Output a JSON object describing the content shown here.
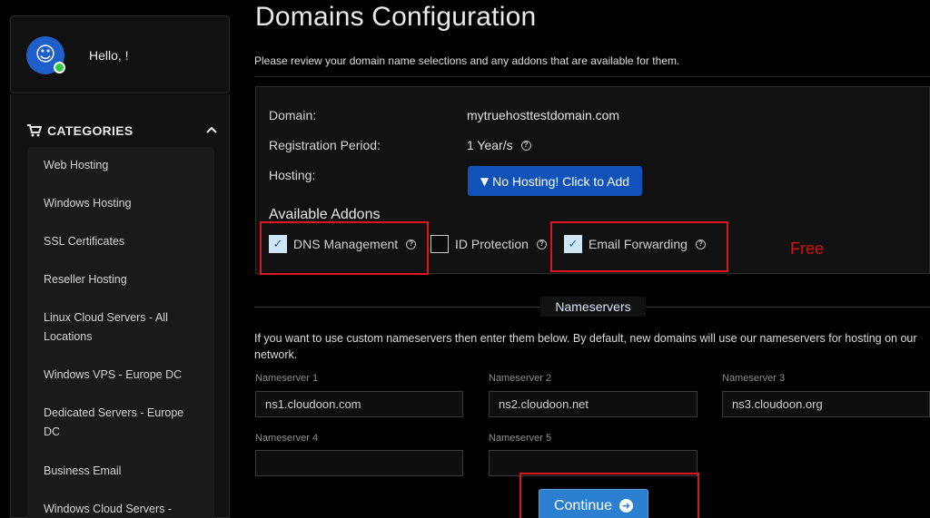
{
  "user": {
    "greeting": "Hello, !"
  },
  "categories": {
    "title": "CATEGORIES",
    "items": [
      "Web Hosting",
      "Windows Hosting",
      "SSL Certificates",
      "Reseller Hosting",
      "Linux Cloud Servers - All Locations",
      "Windows VPS - Europe DC",
      "Dedicated Servers - Europe DC",
      "Business Email",
      "Windows Cloud Servers -"
    ]
  },
  "page": {
    "title": "Domains Configuration",
    "intro": "Please review your domain name selections and any addons that are available for them."
  },
  "domain": {
    "domain_label": "Domain:",
    "domain_value": "mytruehosttestdomain.com",
    "period_label": "Registration Period:",
    "period_value": "1 Year/s",
    "hosting_label": "Hosting:",
    "hosting_button": "No Hosting! Click to Add"
  },
  "addons": {
    "title": "Available Addons",
    "items": [
      {
        "label": "DNS Management",
        "checked": true
      },
      {
        "label": "ID Protection",
        "checked": false
      },
      {
        "label": "Email Forwarding",
        "checked": true
      }
    ],
    "annotation": "Free"
  },
  "nameservers": {
    "title": "Nameservers",
    "help": "If you want to use custom nameservers then enter them below. By default, new domains will use our nameservers for hosting on our network.",
    "fields": [
      {
        "label": "Nameserver 1",
        "value": "ns1.cloudoon.com"
      },
      {
        "label": "Nameserver 2",
        "value": "ns2.cloudoon.net"
      },
      {
        "label": "Nameserver 3",
        "value": "ns3.cloudoon.org"
      },
      {
        "label": "Nameserver 4",
        "value": ""
      },
      {
        "label": "Nameserver 5",
        "value": ""
      }
    ]
  },
  "actions": {
    "continue": "Continue"
  },
  "colors": {
    "accent": "#1152b8",
    "highlight": "#e0141c",
    "online": "#2ecc40"
  }
}
